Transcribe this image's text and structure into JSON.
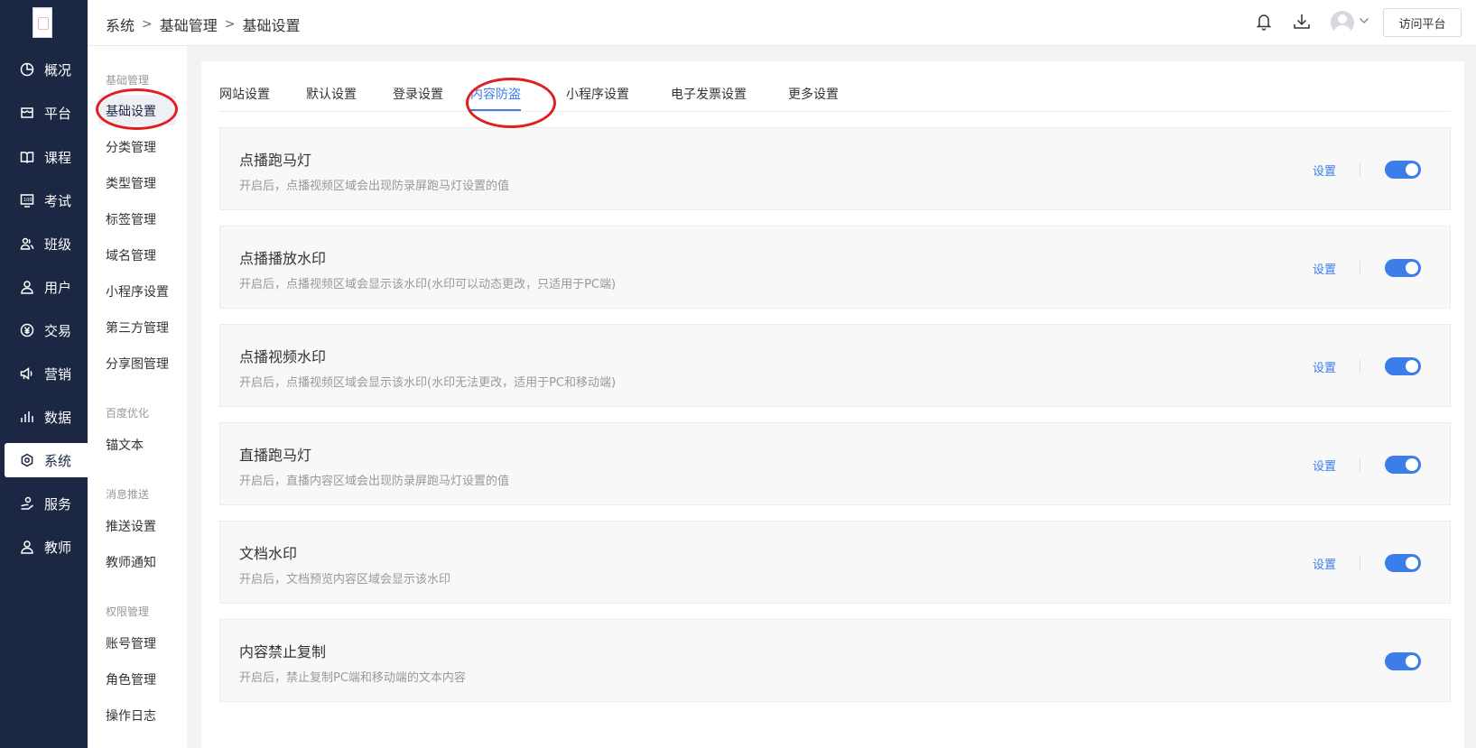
{
  "nav": [
    {
      "label": "概况",
      "icon": "pie-chart-icon"
    },
    {
      "label": "平台",
      "icon": "storefront-icon"
    },
    {
      "label": "课程",
      "icon": "book-icon"
    },
    {
      "label": "考试",
      "icon": "exam-icon"
    },
    {
      "label": "班级",
      "icon": "group-icon"
    },
    {
      "label": "用户",
      "icon": "user-icon"
    },
    {
      "label": "交易",
      "icon": "yen-icon"
    },
    {
      "label": "营销",
      "icon": "megaphone-icon"
    },
    {
      "label": "数据",
      "icon": "bar-chart-icon"
    },
    {
      "label": "系统",
      "icon": "gear-icon"
    },
    {
      "label": "服务",
      "icon": "service-icon"
    },
    {
      "label": "教师",
      "icon": "teacher-icon"
    }
  ],
  "submenu": {
    "groups": [
      "基础管理",
      "百度优化",
      "消息推送",
      "权限管理"
    ],
    "items": [
      "基础设置",
      "分类管理",
      "类型管理",
      "标签管理",
      "域名管理",
      "小程序设置",
      "第三方管理",
      "分享图管理",
      "锚文本",
      "推送设置",
      "教师通知",
      "账号管理",
      "角色管理",
      "操作日志"
    ]
  },
  "breadcrumb": [
    "系统",
    "基础管理",
    "基础设置"
  ],
  "header": {
    "visit_label": "访问平台"
  },
  "tabs": [
    "网站设置",
    "默认设置",
    "登录设置",
    "内容防盗",
    "小程序设置",
    "电子发票设置",
    "更多设置"
  ],
  "cards": [
    {
      "title": "点播跑马灯",
      "desc": "开启后，点播视频区域会出现防录屏跑马灯设置的值",
      "link": "设置",
      "enabled": true
    },
    {
      "title": "点播播放水印",
      "desc": "开启后，点播视频区域会显示该水印(水印可以动态更改，只适用于PC端)",
      "link": "设置",
      "enabled": true
    },
    {
      "title": "点播视频水印",
      "desc": "开启后，点播视频区域会显示该水印(水印无法更改，适用于PC和移动端)",
      "link": "设置",
      "enabled": true
    },
    {
      "title": "直播跑马灯",
      "desc": "开启后，直播内容区域会出现防录屏跑马灯设置的值",
      "link": "设置",
      "enabled": true
    },
    {
      "title": "文档水印",
      "desc": "开启后，文档预览内容区域会显示该水印",
      "link": "设置",
      "enabled": true
    },
    {
      "title": "内容禁止复制",
      "desc": "开启后，禁止复制PC端和移动端的文本内容",
      "enabled": true
    }
  ],
  "colors": {
    "nav_bg": "#1b2743",
    "accent": "#3b7de9",
    "annotation": "#e02020"
  }
}
